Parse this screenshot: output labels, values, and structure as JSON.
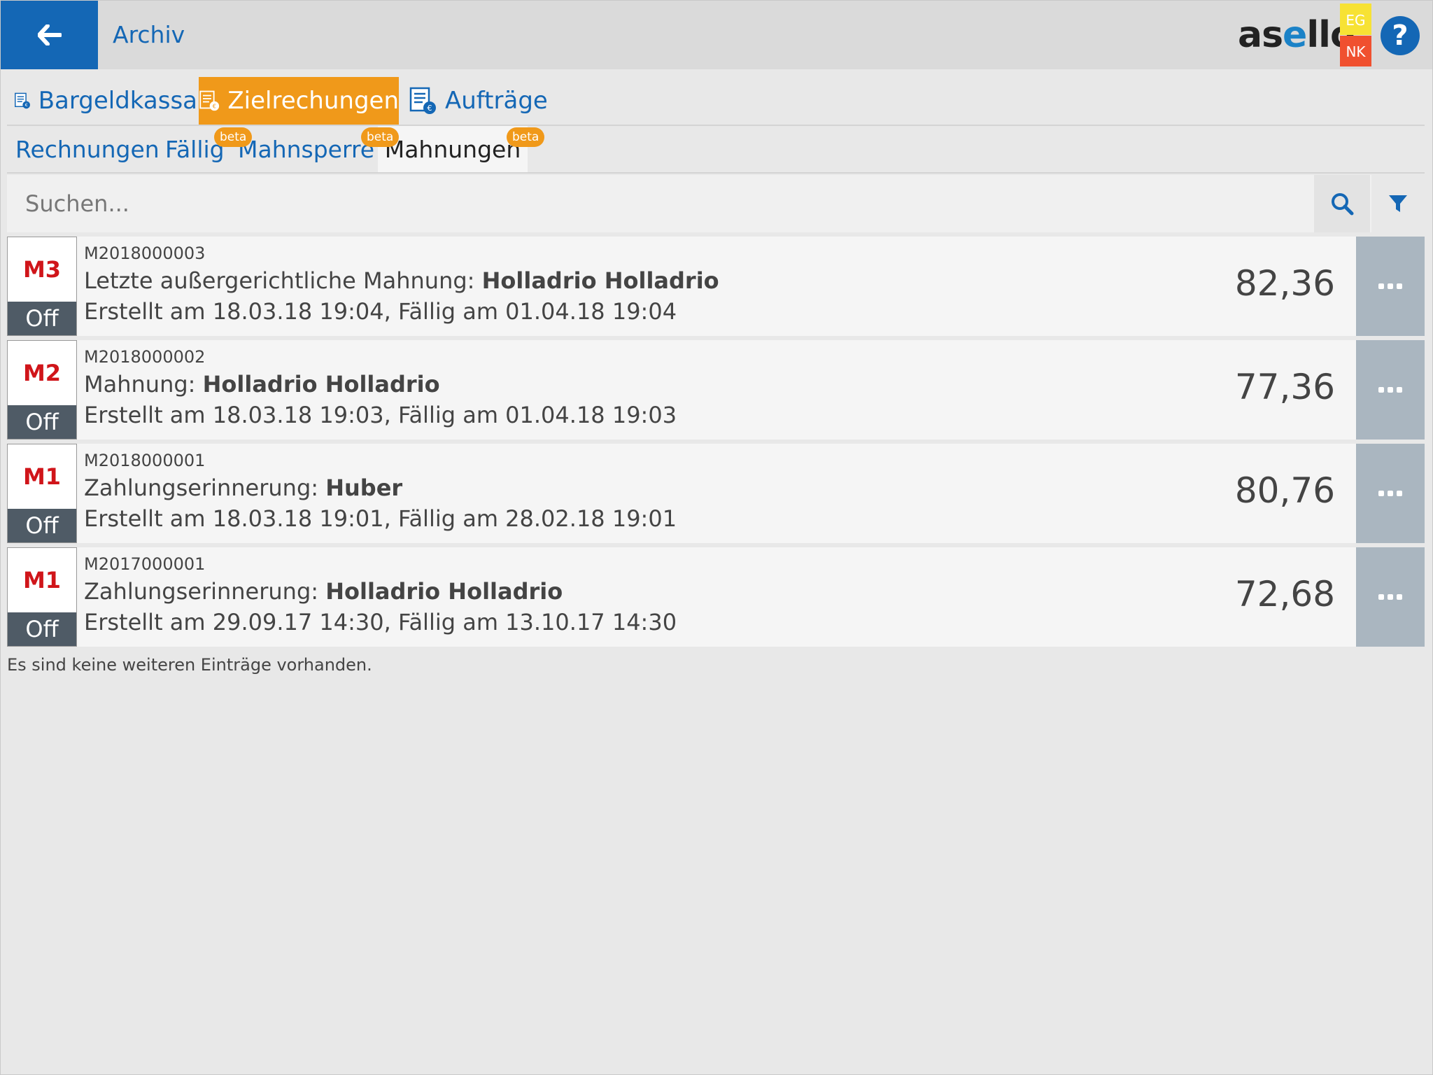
{
  "header": {
    "title": "Archiv",
    "logo_prefix": "as",
    "logo_accent": "e",
    "logo_suffix": "llo",
    "badge_top": "EG",
    "badge_bottom": "NK",
    "help_label": "?"
  },
  "main_tabs": [
    {
      "label": "Bargeldkassa",
      "icon": "cash-register-doc-icon",
      "active": false
    },
    {
      "label": "Zielrechungen",
      "icon": "invoice-doc-icon",
      "active": true
    },
    {
      "label": "Aufträge",
      "icon": "order-doc-icon",
      "active": false
    }
  ],
  "sub_tabs": [
    {
      "label": "Rechnungen",
      "active": false
    },
    {
      "label": "Fällig",
      "active": false,
      "badge": "beta"
    },
    {
      "label": "Mahnsperre",
      "active": false,
      "badge": "beta"
    },
    {
      "label": "Mahnungen",
      "active": true,
      "badge": "beta"
    }
  ],
  "search": {
    "placeholder": "Suchen..."
  },
  "reminders": [
    {
      "level": "M3",
      "status": "Off",
      "id": "M2018000003",
      "type": "Letzte außergerichtliche Mahnung:",
      "customer": "Holladrio Holladrio",
      "dates": "Erstellt am 18.03.18 19:04, Fällig am 01.04.18 19:04",
      "amount": "82,36"
    },
    {
      "level": "M2",
      "status": "Off",
      "id": "M2018000002",
      "type": "Mahnung:",
      "customer": "Holladrio Holladrio",
      "dates": "Erstellt am 18.03.18 19:03, Fällig am 01.04.18 19:03",
      "amount": "77,36"
    },
    {
      "level": "M1",
      "status": "Off",
      "id": "M2018000001",
      "type": "Zahlungserinnerung:",
      "customer": "Huber",
      "dates": "Erstellt am 18.03.18 19:01, Fällig am 28.02.18 19:01",
      "amount": "80,76"
    },
    {
      "level": "M1",
      "status": "Off",
      "id": "M2017000001",
      "type": "Zahlungserinnerung:",
      "customer": "Holladrio Holladrio",
      "dates": "Erstellt am 29.09.17 14:30, Fällig am 13.10.17 14:30",
      "amount": "72,68"
    }
  ],
  "footer_note": "Es sind keine weiteren Einträge vorhanden.",
  "colors": {
    "primary": "#1467b5",
    "accent": "#f0991a",
    "danger": "#d0151a",
    "status_bg": "#4f5b66"
  }
}
